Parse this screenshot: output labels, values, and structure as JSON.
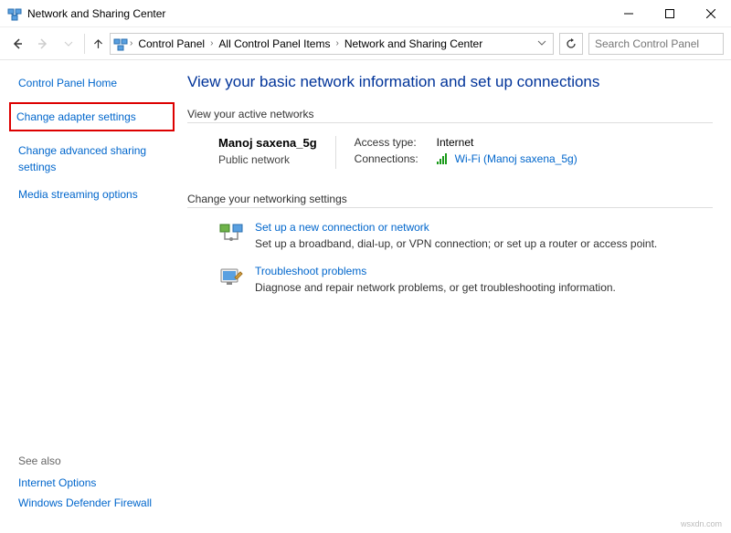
{
  "window": {
    "title": "Network and Sharing Center"
  },
  "breadcrumb": {
    "items": [
      "Control Panel",
      "All Control Panel Items",
      "Network and Sharing Center"
    ]
  },
  "search": {
    "placeholder": "Search Control Panel"
  },
  "sidebar": {
    "control_panel_home": "Control Panel Home",
    "change_adapter": "Change adapter settings",
    "change_advanced": "Change advanced sharing settings",
    "media_stream": "Media streaming options"
  },
  "see_also": {
    "header": "See also",
    "internet_options": "Internet Options",
    "firewall": "Windows Defender Firewall"
  },
  "main": {
    "title": "View your basic network information and set up connections",
    "active_header": "View your active networks",
    "network": {
      "name": "Manoj saxena_5g",
      "type": "Public network",
      "access_label": "Access type:",
      "access_value": "Internet",
      "conn_label": "Connections:",
      "conn_value": "Wi-Fi (Manoj saxena_5g)"
    },
    "change_header": "Change your networking settings",
    "setup": {
      "title": "Set up a new connection or network",
      "desc": "Set up a broadband, dial-up, or VPN connection; or set up a router or access point."
    },
    "troubleshoot": {
      "title": "Troubleshoot problems",
      "desc": "Diagnose and repair network problems, or get troubleshooting information."
    }
  },
  "watermark": "wsxdn.com"
}
